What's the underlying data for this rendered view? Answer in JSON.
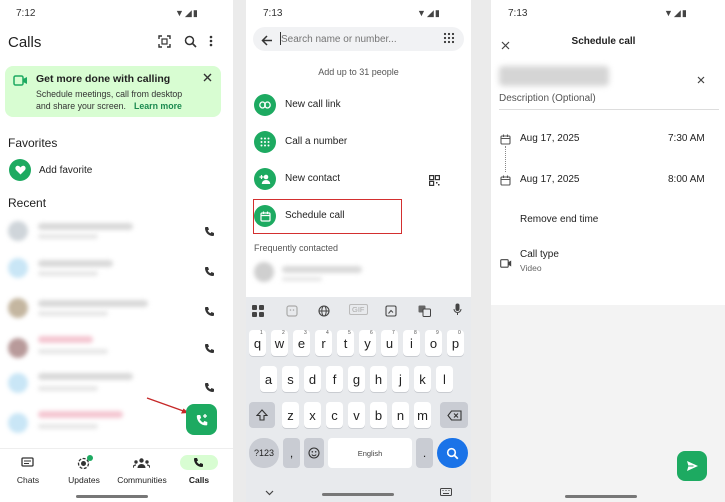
{
  "calls_screen": {
    "time": "7:12",
    "title": "Calls",
    "promo_title": "Get more done with calling",
    "promo_body_line1": "Schedule meetings, call from desktop",
    "promo_body_line2": "and share your screen.",
    "promo_link": "Learn more",
    "favorites_heading": "Favorites",
    "add_favorite": "Add favorite",
    "recent_heading": "Recent",
    "nav": [
      {
        "label": "Chats",
        "icon": "chats-icon"
      },
      {
        "label": "Updates",
        "icon": "updates-icon"
      },
      {
        "label": "Communities",
        "icon": "communities-icon"
      },
      {
        "label": "Calls",
        "icon": "calls-icon"
      }
    ]
  },
  "new_call_screen": {
    "time": "7:13",
    "search_placeholder": "Search name or number...",
    "add_up_to": "Add up to 31 people",
    "options": [
      {
        "label": "New call link",
        "icon": "link-icon"
      },
      {
        "label": "Call a number",
        "icon": "dialpad-icon"
      },
      {
        "label": "New contact",
        "icon": "add-person-icon"
      },
      {
        "label": "Schedule call",
        "icon": "calendar-icon"
      }
    ],
    "frequently_contacted": "Frequently contacted",
    "keyboard": {
      "row1": [
        "q",
        "w",
        "e",
        "r",
        "t",
        "y",
        "u",
        "i",
        "o",
        "p"
      ],
      "row1_digits": [
        "1",
        "2",
        "3",
        "4",
        "5",
        "6",
        "7",
        "8",
        "9",
        "0"
      ],
      "row2": [
        "a",
        "s",
        "d",
        "f",
        "g",
        "h",
        "j",
        "k",
        "l"
      ],
      "row3": [
        "z",
        "x",
        "c",
        "v",
        "b",
        "n",
        "m"
      ],
      "symbols_key": "?123",
      "space_label": "English",
      "toolbar_gif": "GIF",
      "comma": ",",
      "period": "."
    }
  },
  "schedule_screen": {
    "time": "7:13",
    "title": "Schedule call",
    "description_placeholder": "Description (Optional)",
    "start_date": "Aug 17, 2025",
    "start_time": "7:30 AM",
    "end_date": "Aug 17, 2025",
    "end_time": "8:00 AM",
    "remove_end_time": "Remove end time",
    "call_type_label": "Call type",
    "call_type_value": "Video"
  },
  "colors": {
    "accent": "#1daa61",
    "promo_bg": "#d8fdd2",
    "highlight": "#d32f2f",
    "keyboard_bg": "#e8eaed",
    "search_key": "#1a73e8"
  }
}
